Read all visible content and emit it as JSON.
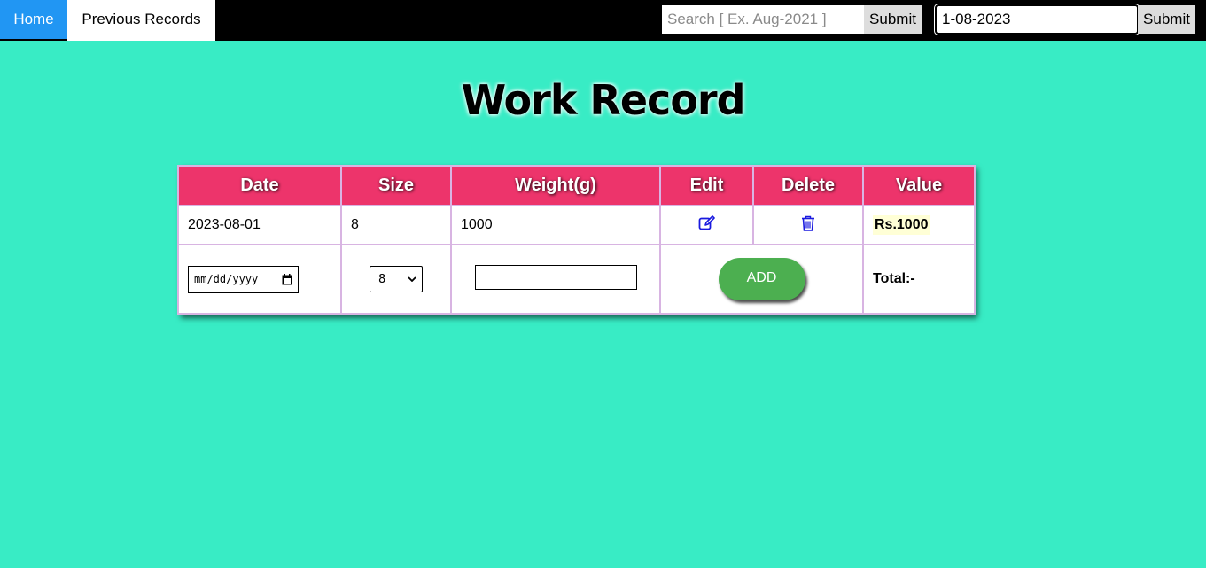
{
  "nav": {
    "home": "Home",
    "previous_records": "Previous Records"
  },
  "search": {
    "placeholder": "Search [ Ex. Aug-2021 ]",
    "submit_label": "Submit",
    "date_value": "1-08-2023",
    "submit2_label": "Submit"
  },
  "page": {
    "title": "Work Record"
  },
  "table": {
    "headers": [
      "Date",
      "Size",
      "Weight(g)",
      "Edit",
      "Delete",
      "Value"
    ],
    "rows": [
      {
        "date": "2023-08-01",
        "size": "8",
        "weight": "1000",
        "value": "Rs.1000"
      }
    ]
  },
  "form": {
    "date_placeholder": "mm/dd/yyyy",
    "size_selected": "8",
    "add_label": "ADD",
    "total_label": "Total:-"
  },
  "colors": {
    "background": "#38ecc5",
    "header": "#ed346b",
    "home_active": "#2196f3",
    "add_button": "#4caf50",
    "icon": "#1a1adf"
  },
  "icons": {
    "edit": "edit-icon",
    "delete": "trash-icon",
    "calendar": "calendar-icon",
    "dropdown": "chevron-down-icon"
  }
}
